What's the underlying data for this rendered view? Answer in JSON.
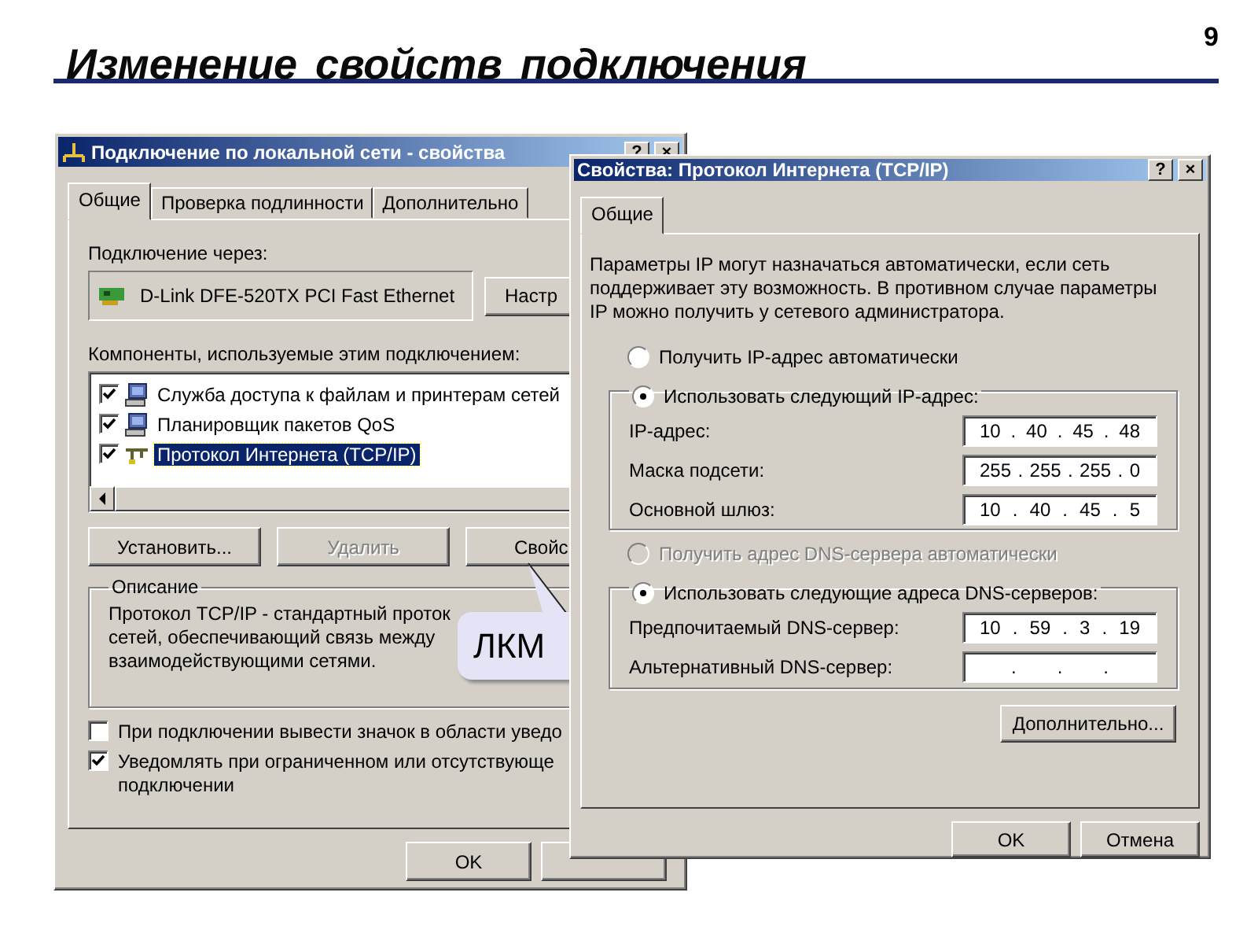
{
  "slide": {
    "title": "Изменение свойств подключения",
    "page_number": "9"
  },
  "connection_window": {
    "title": "Подключение по локальной сети - свойства",
    "help_button": "?",
    "close_button": "×",
    "tabs": [
      {
        "label": "Общие",
        "selected": true
      },
      {
        "label": "Проверка подлинности",
        "selected": false
      },
      {
        "label": "Дополнительно",
        "selected": false
      }
    ],
    "connect_via_label": "Подключение через:",
    "adapter": "D-Link DFE-520TX PCI Fast Ethernet",
    "configure_button": "Настр",
    "components_label": "Компоненты, используемые этим подключением:",
    "components": [
      {
        "kind": "service",
        "label": "Служба доступа к файлам и принтерам сетей",
        "checked": true,
        "selected": false
      },
      {
        "kind": "service",
        "label": "Планировщик пакетов QoS",
        "checked": true,
        "selected": false
      },
      {
        "kind": "protocol",
        "label": "Протокол Интернета (TCP/IP)",
        "checked": true,
        "selected": true
      }
    ],
    "component_buttons": [
      {
        "label": "Установить...",
        "disabled": false
      },
      {
        "label": "Удалить",
        "disabled": true
      },
      {
        "label": "Свойс",
        "disabled": false
      }
    ],
    "description": {
      "legend": "Описание",
      "lines": [
        "Протокол TCP/IP - стандартный проток",
        "сетей, обеспечивающий связь между",
        "взаимодействующими сетями."
      ]
    },
    "options": [
      {
        "lines": [
          "При подключении вывести значок в области уведо"
        ],
        "checked": false
      },
      {
        "lines": [
          "Уведомлять при ограниченном или отсутствующе",
          "подключении"
        ],
        "checked": true
      }
    ],
    "ok_button": "OK"
  },
  "callout": {
    "text": "ЛКМ"
  },
  "tcpip_window": {
    "title": "Свойства: Протокол Интернета (TCP/IP)",
    "help_button": "?",
    "close_button": "×",
    "tabs": [
      {
        "label": "Общие",
        "selected": true
      }
    ],
    "intro_lines": [
      "Параметры IP могут назначаться автоматически, если сеть",
      "поддерживает эту возможность. В противном случае параметры",
      "IP можно получить у сетевого администратора."
    ],
    "ip_mode": [
      {
        "label": "Получить IP-адрес автоматически",
        "selected": false,
        "disabled": false
      },
      {
        "label": "Использовать следующий IP-адрес:",
        "selected": true,
        "disabled": false
      }
    ],
    "ip_fields": [
      {
        "label": "IP-адрес:",
        "value": "10 . 40 . 45 . 48"
      },
      {
        "label": "Маска подсети:",
        "value": "255 . 255 . 255 . 0"
      },
      {
        "label": "Основной шлюз:",
        "value": "10 . 40 . 45 . 5"
      }
    ],
    "dns_mode": [
      {
        "label": "Получить адрес DNS-сервера автоматически",
        "selected": false,
        "disabled": true
      },
      {
        "label": "Использовать следующие адреса DNS-серверов:",
        "selected": true,
        "disabled": false
      }
    ],
    "dns_fields": [
      {
        "label": "Предпочитаемый DNS-сервер:",
        "value": "10 . 59 . 3 . 19"
      },
      {
        "label": "Альтернативный DNS-сервер:",
        "value": ". . ."
      }
    ],
    "advanced_button": "Дополнительно...",
    "ok_button": "OK",
    "cancel_button": "Отмена"
  }
}
